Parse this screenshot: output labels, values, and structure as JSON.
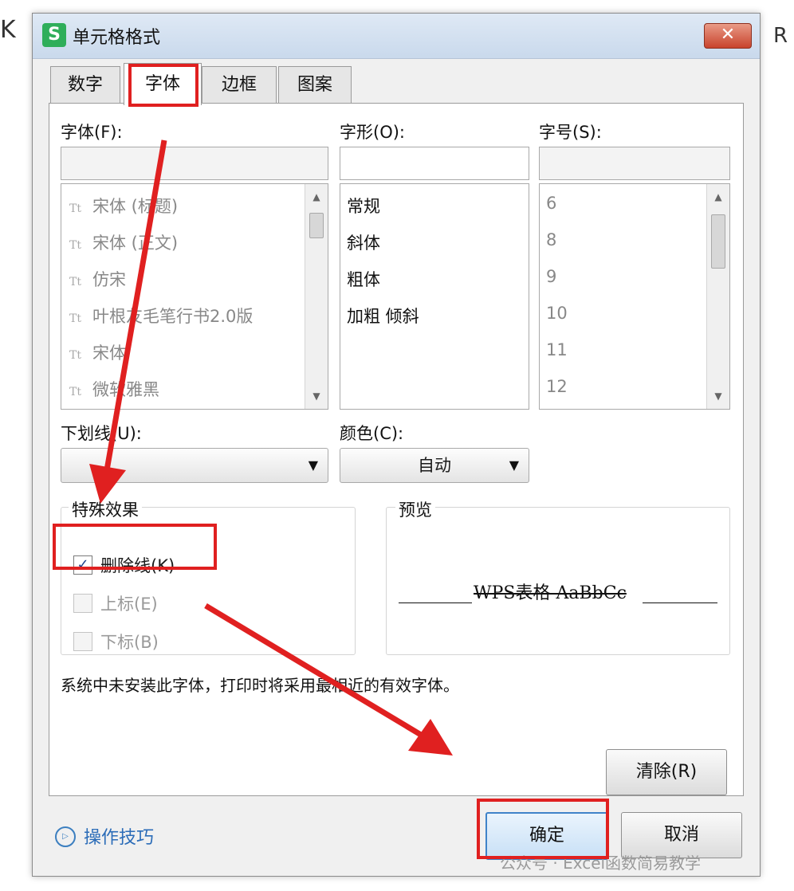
{
  "background": {
    "left_glyph": "K",
    "right_glyph": "R"
  },
  "window": {
    "title": "单元格格式",
    "app_icon": "S",
    "close_glyph": "✕"
  },
  "tabs": [
    {
      "label": "数字",
      "active": false
    },
    {
      "label": "字体",
      "active": true
    },
    {
      "label": "边框",
      "active": false
    },
    {
      "label": "图案",
      "active": false
    }
  ],
  "font_section": {
    "label": "字体(F):",
    "input_value": "",
    "items": [
      "宋体 (标题)",
      "宋体 (正文)",
      "仿宋",
      "叶根友毛笔行书2.0版",
      "宋体",
      "微软雅黑"
    ],
    "item_icon": "Tt"
  },
  "style_section": {
    "label": "字形(O):",
    "input_value": "",
    "items": [
      "常规",
      "斜体",
      "粗体",
      "加粗 倾斜"
    ]
  },
  "size_section": {
    "label": "字号(S):",
    "input_value": "",
    "items": [
      "6",
      "8",
      "9",
      "10",
      "11",
      "12"
    ]
  },
  "underline": {
    "label": "下划线(U):",
    "value": ""
  },
  "color": {
    "label": "颜色(C):",
    "value": "自动"
  },
  "effects": {
    "title": "特殊效果",
    "strikethrough": {
      "label": "删除线(K)",
      "checked": true,
      "check_glyph": "✓"
    },
    "superscript": {
      "label": "上标(E)",
      "checked": false
    },
    "subscript": {
      "label": "下标(B)",
      "checked": false
    }
  },
  "preview": {
    "title": "预览",
    "sample_text": "WPS表格 AaBbCc"
  },
  "hint_text": "系统中未安装此字体，打印时将采用最相近的有效字体。",
  "buttons": {
    "clear": "清除(R)",
    "ok": "确定",
    "cancel": "取消"
  },
  "tips": {
    "label": "操作技巧",
    "icon_glyph": "▷"
  },
  "watermark": "公众号 · Excel函数简易教学",
  "annotation_color": "#e02020",
  "accent_color": "#3f83c9"
}
